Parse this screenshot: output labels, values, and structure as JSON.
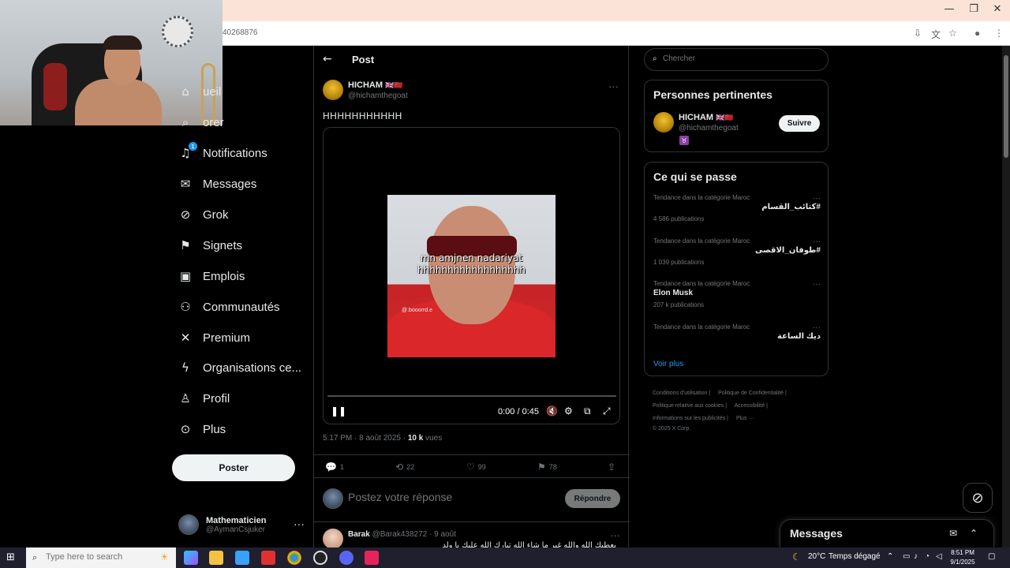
{
  "browser": {
    "url": "40268876",
    "window_controls": [
      "—",
      "❐",
      "✕"
    ]
  },
  "nav": {
    "items": [
      {
        "label": "ueil",
        "icon": "home-icon"
      },
      {
        "label": "orer",
        "icon": "explore-icon"
      },
      {
        "label": "Notifications",
        "icon": "bell-icon",
        "badge": "1"
      },
      {
        "label": "Messages",
        "icon": "mail-icon"
      },
      {
        "label": "Grok",
        "icon": "grok-icon"
      },
      {
        "label": "Signets",
        "icon": "bookmark-icon"
      },
      {
        "label": "Emplois",
        "icon": "briefcase-icon"
      },
      {
        "label": "Communautés",
        "icon": "communities-icon"
      },
      {
        "label": "Premium",
        "icon": "x-logo-icon"
      },
      {
        "label": "Organisations ce...",
        "icon": "lightning-icon"
      },
      {
        "label": "Profil",
        "icon": "person-icon"
      },
      {
        "label": "Plus",
        "icon": "more-circle-icon"
      }
    ],
    "post_button": "Poster",
    "account": {
      "name": "Mathematicien",
      "handle": "@AymanCsjuker"
    }
  },
  "post": {
    "header_title": "Post",
    "author_name": "HICHAM",
    "author_flags": "🇬🇧🇲🇦",
    "author_handle": "@hichamthegoat",
    "text": "HHHHHHHHHHH",
    "video": {
      "caption_line1": "mn amjnen nadariyat",
      "caption_line2": "hhhhhhhhhhhhhhhhhh",
      "watermark": "@.booorrd.e",
      "time": "0:00 / 0:45",
      "progress": 0.0
    },
    "time": "5:17 PM · 8 août 2025 · ",
    "views_count": "10 k",
    "views_label": " vues",
    "stats": {
      "replies": "1",
      "reposts": "22",
      "likes": "99",
      "bookmarks": "78"
    }
  },
  "reply": {
    "placeholder": "Postez votre réponse",
    "button": "Répondre"
  },
  "comment": {
    "name": "Barak",
    "handle": "@Barak438272 · 9 août",
    "text": "يعطيك الله والله غير ما شاء الله تبارك الله عليك يا ولد"
  },
  "sidebar": {
    "search_placeholder": "Chercher",
    "relevant_title": "Personnes pertinentes",
    "relevant_person": {
      "name": "HICHAM",
      "flags": "🇬🇧🇲🇦",
      "handle": "@hichamthegoat",
      "badge": "♉"
    },
    "follow_button": "Suivre",
    "trends_title": "Ce qui se passe",
    "trends": [
      {
        "category": "Tendance dans la catégorie Maroc",
        "name": "#كتائب_القسام",
        "count": "4 586 publications",
        "rtl": true
      },
      {
        "category": "Tendance dans la catégorie Maroc",
        "name": "#طوفان_الاقصى",
        "count": "1 039 publications",
        "rtl": true
      },
      {
        "category": "Tendance dans la catégorie Maroc",
        "name": "Elon Musk",
        "count": "207 k publications",
        "rtl": false
      },
      {
        "category": "Tendance dans la catégorie Maroc",
        "name": "ديك الساعة",
        "count": "",
        "rtl": true
      }
    ],
    "see_more": "Voir plus",
    "footer": [
      "Conditions d'utilisation |",
      "Politique de Confidentialité |",
      "Politique relative aux cookies |",
      "Accessibilité |",
      "Informations sur les publicités |",
      "Plus ···",
      "© 2025 X Corp."
    ]
  },
  "messages_drawer": {
    "title": "Messages"
  },
  "taskbar": {
    "search_placeholder": "Type here to search",
    "weather": "20°C",
    "weather_text": "Temps dégagé",
    "time": "8:51 PM",
    "date": "9/1/2025"
  }
}
